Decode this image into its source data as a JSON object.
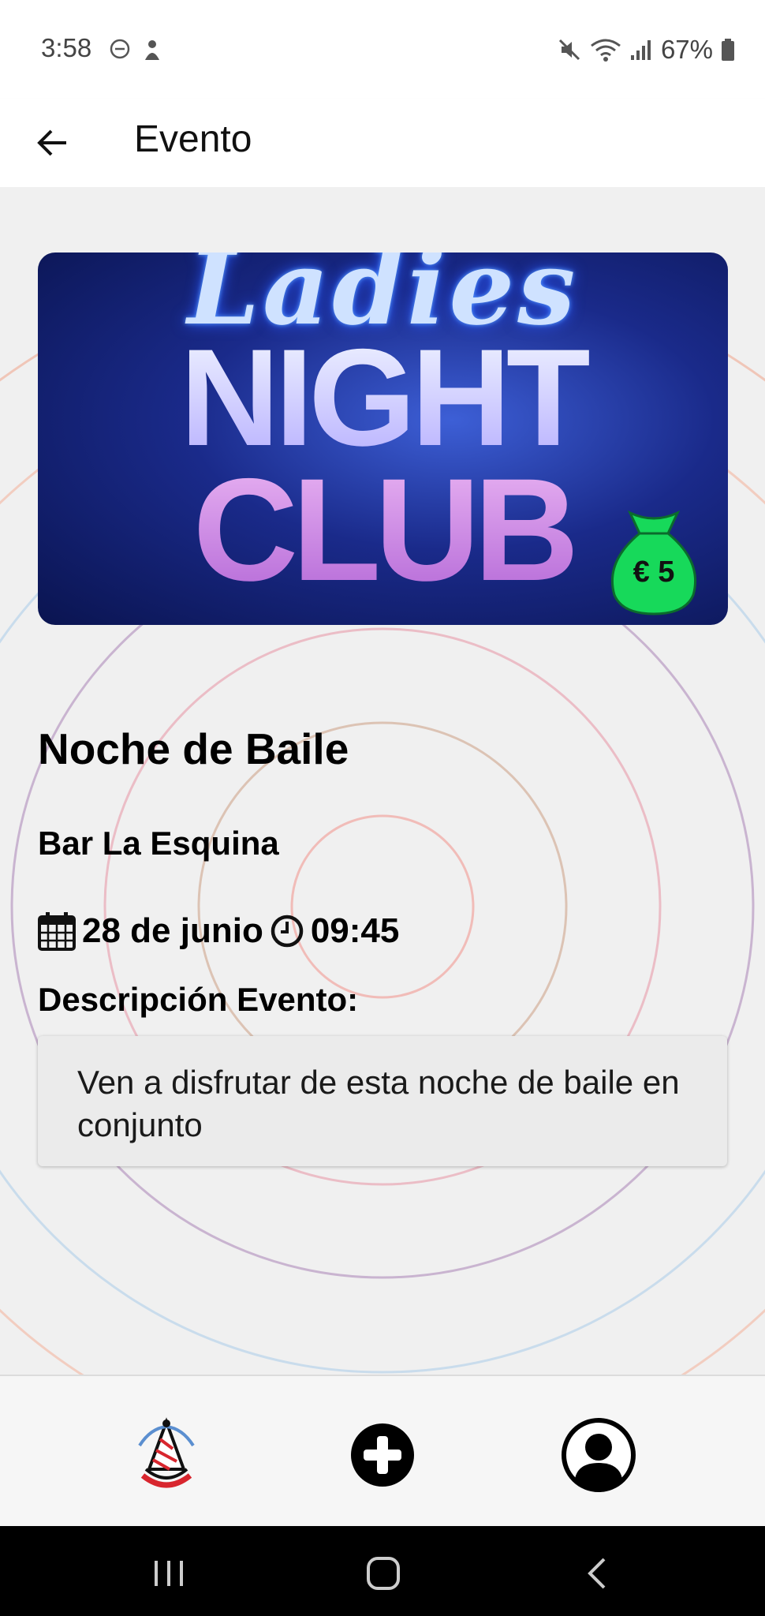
{
  "status_bar": {
    "time": "3:58",
    "battery": "67%"
  },
  "app_bar": {
    "title": "Evento"
  },
  "banner": {
    "line1": "Ladies",
    "line2": "NIGHT",
    "line3": "CLUB",
    "price": "€ 5"
  },
  "event": {
    "title": "Noche de Baile",
    "venue": "Bar La Esquina",
    "date": "28 de junio",
    "time": "09:45",
    "description_label": "Descripción Evento:",
    "description": "Ven a disfrutar de esta noche de baile en conjunto"
  },
  "bottom_nav": {
    "items": [
      "party-hat-icon",
      "add-icon",
      "profile-icon"
    ]
  },
  "colors": {
    "price_badge": "#17d95a",
    "background": "#f0f0f0",
    "nav_background": "#f6f6f6"
  }
}
